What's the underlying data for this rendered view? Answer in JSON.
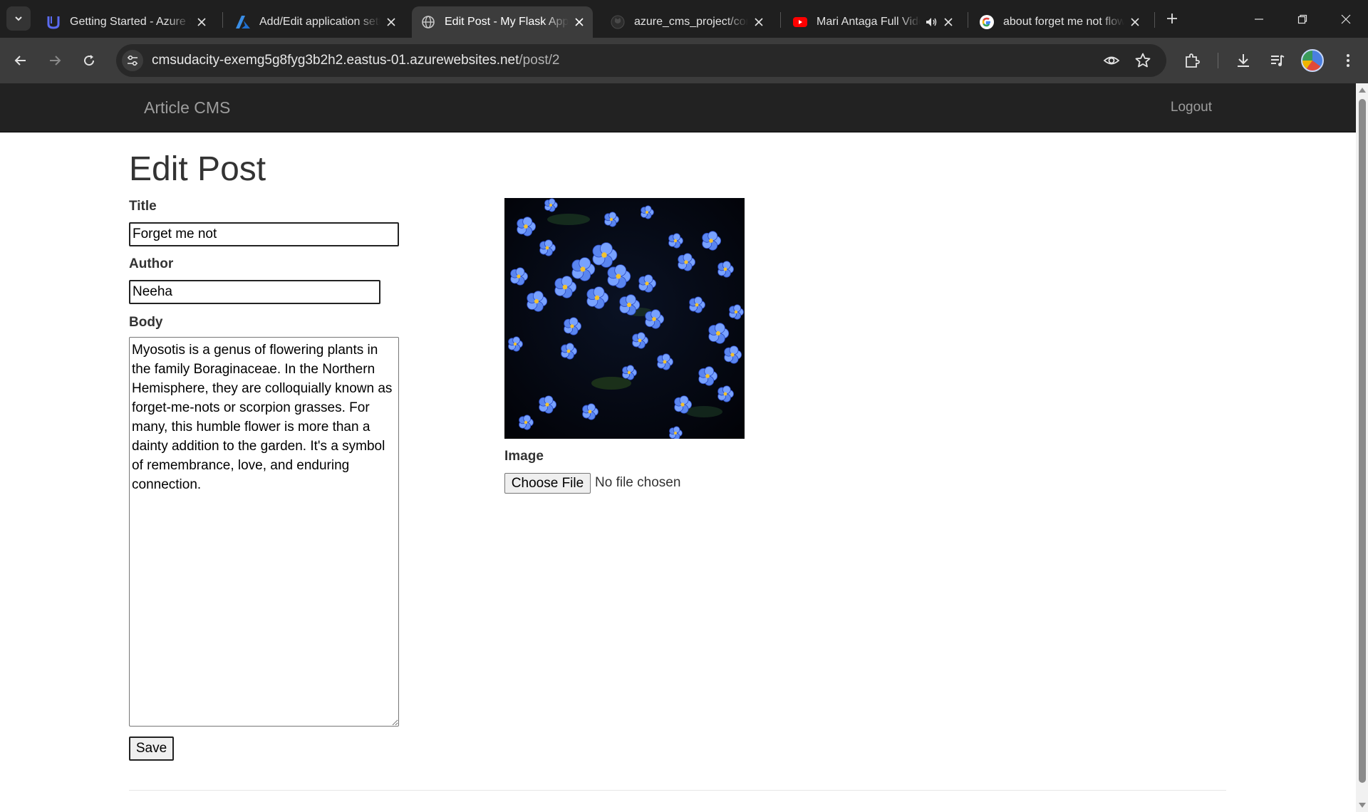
{
  "browser": {
    "tabs": [
      {
        "title": "Getting Started - Azure S",
        "icon": "udacity-icon"
      },
      {
        "title": "Add/Edit application setti",
        "icon": "azure-icon"
      },
      {
        "title": "Edit Post - My Flask Appli",
        "icon": "globe-icon",
        "active": true
      },
      {
        "title": "azure_cms_project/config",
        "icon": "github-icon"
      },
      {
        "title": "Mari Antaga Full Vide",
        "icon": "youtube-icon",
        "audio": true
      },
      {
        "title": "about forget me not flow",
        "icon": "google-icon"
      }
    ],
    "url_host": "cmsudacity-exemg5g8fyg3b2h2.eastus-01.azurewebsites.net",
    "url_path": "/post/2"
  },
  "navbar": {
    "brand": "Article CMS",
    "logout": "Logout"
  },
  "form": {
    "heading": "Edit Post",
    "title_label": "Title",
    "title_value": "Forget me not",
    "author_label": "Author",
    "author_value": "Neeha",
    "body_label": "Body",
    "body_value": "Myosotis is a genus of flowering plants in the family Boraginaceae. In the Northern Hemisphere, they are colloquially known as forget-me-nots or scorpion grasses. For many, this humble flower is more than a dainty addition to the garden. It's a symbol of remembrance, love, and enduring connection.",
    "save_label": "Save",
    "image_label": "Image",
    "file_button": "Choose File",
    "file_status": "No file chosen"
  },
  "colors": {
    "tab_strip": "#1f1f1f",
    "toolbar": "#3c3c3c",
    "navbar": "#222222",
    "navbar_text": "#9d9d9d"
  }
}
